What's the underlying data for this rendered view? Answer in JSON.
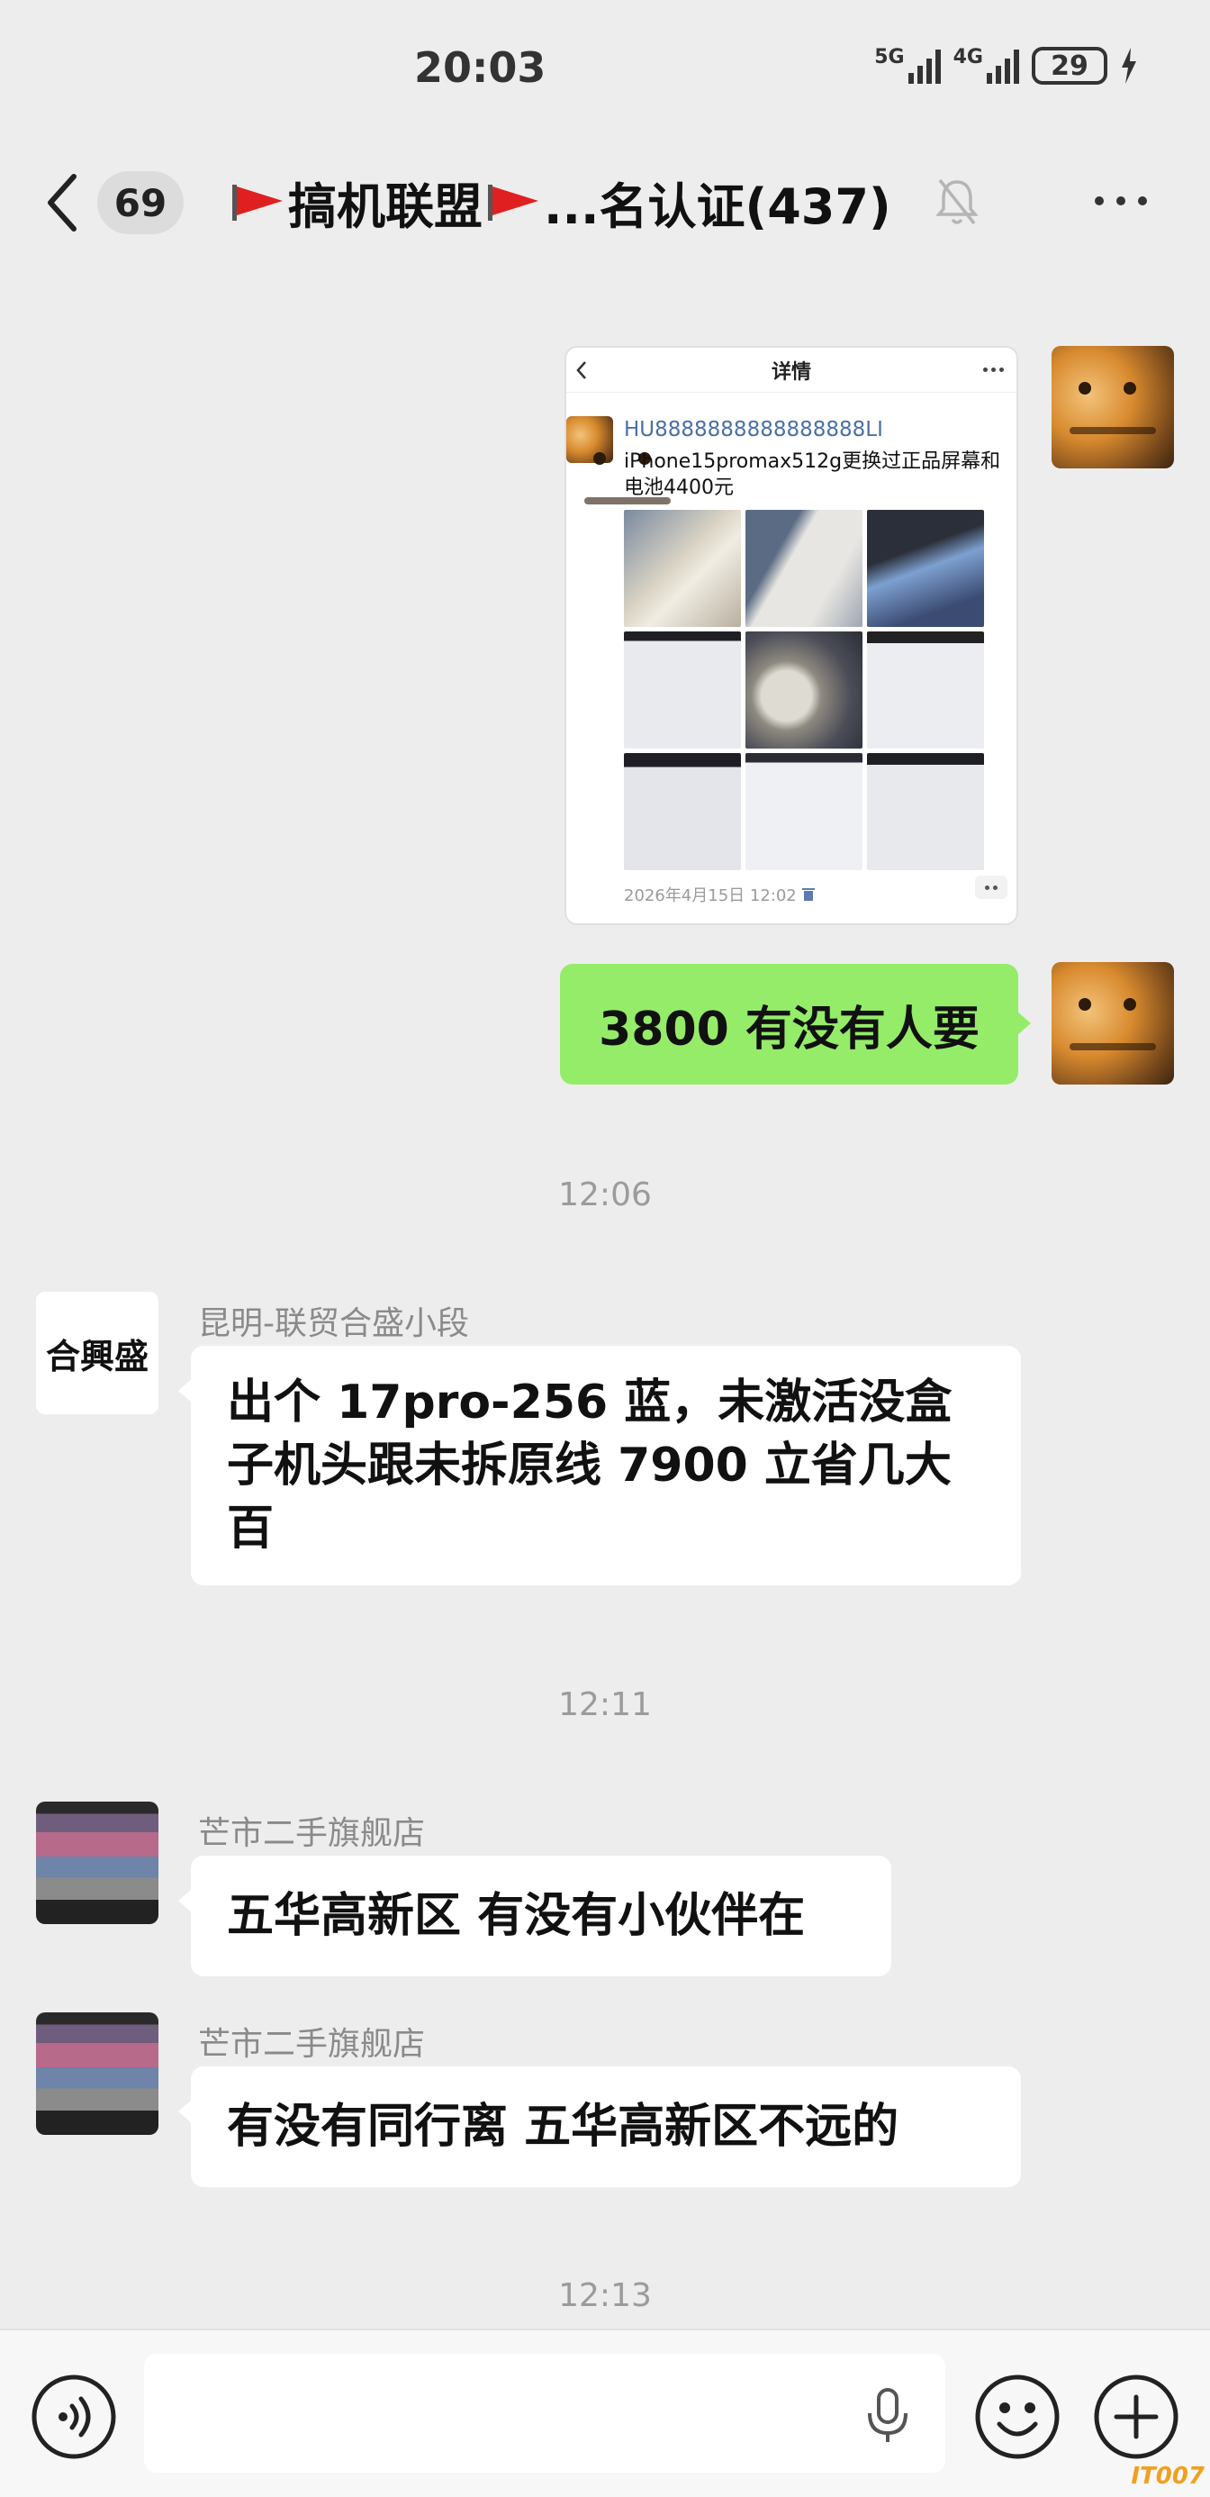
{
  "status_bar": {
    "time": "20:03",
    "net1": "5G",
    "net2": "4G",
    "battery": "29"
  },
  "nav": {
    "unread_count": "69",
    "title": "搞机联盟",
    "title_suffix": "...名认证(437)"
  },
  "messages": {
    "card": {
      "header": "详情",
      "user": "HU8888888888888888LI",
      "text": "iPhone15promax512g更换过正品屏幕和电池4400元",
      "footer": "2026年4月15日 12:02"
    },
    "sent_text": "3800 有没有人要",
    "time1": "12:06",
    "recv1": {
      "sender": "昆明-联贸合盛小段",
      "avatar_text": "合興盛",
      "text": "出个 17pro-256 蓝，未激活没盒子机头跟未拆原线 7900 立省几大百"
    },
    "time2": "12:11",
    "recv2": {
      "sender": "芒市二手旗舰店",
      "text": "五华高新区 有没有小伙伴在"
    },
    "recv3": {
      "sender": "芒市二手旗舰店",
      "text": "有没有同行离 五华高新区不远的"
    },
    "time3": "12:13"
  },
  "input": {
    "value": ""
  },
  "watermark": "IT007",
  "colors": {
    "background": "#ededed",
    "sent_bubble": "#95ec69",
    "received_bubble": "#ffffff",
    "card_user": "#4a6fa5"
  },
  "icons": [
    "back-icon",
    "flag-icon",
    "mute-icon",
    "more-icon",
    "trash-icon",
    "voice-icon",
    "mic-icon",
    "emoji-icon",
    "plus-icon"
  ]
}
